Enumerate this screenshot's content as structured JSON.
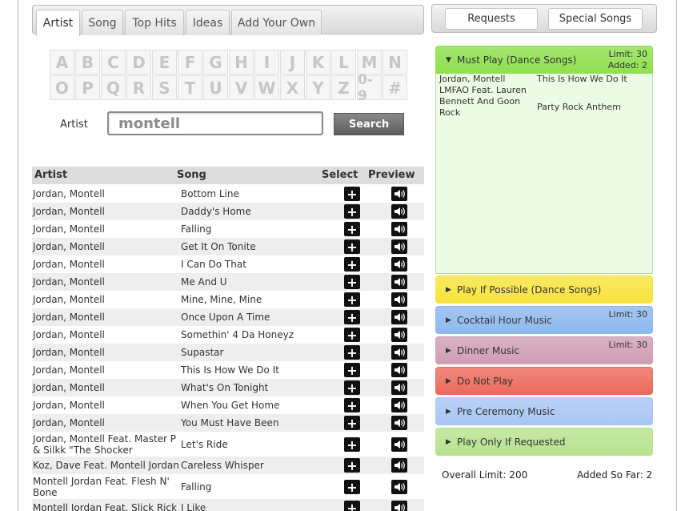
{
  "tabs": [
    {
      "label": "Artist",
      "active": true
    },
    {
      "label": "Song",
      "active": false
    },
    {
      "label": "Top Hits",
      "active": false
    },
    {
      "label": "Ideas",
      "active": false
    },
    {
      "label": "Add Your Own",
      "active": false
    }
  ],
  "letters": [
    "A",
    "B",
    "C",
    "D",
    "E",
    "F",
    "G",
    "H",
    "I",
    "J",
    "K",
    "L",
    "M",
    "N",
    "O",
    "P",
    "Q",
    "R",
    "S",
    "T",
    "U",
    "V",
    "W",
    "X",
    "Y",
    "Z",
    "0-9",
    "#"
  ],
  "search": {
    "label": "Artist",
    "value": "montell",
    "button": "Search"
  },
  "table": {
    "headers": {
      "artist": "Artist",
      "song": "Song",
      "select": "Select",
      "preview": "Preview"
    },
    "rows": [
      {
        "artist": "Jordan, Montell",
        "song": "Bottom Line"
      },
      {
        "artist": "Jordan, Montell",
        "song": "Daddy's Home"
      },
      {
        "artist": "Jordan, Montell",
        "song": "Falling"
      },
      {
        "artist": "Jordan, Montell",
        "song": "Get It On Tonite"
      },
      {
        "artist": "Jordan, Montell",
        "song": "I Can Do That"
      },
      {
        "artist": "Jordan, Montell",
        "song": "Me And U"
      },
      {
        "artist": "Jordan, Montell",
        "song": "Mine, Mine, Mine"
      },
      {
        "artist": "Jordan, Montell",
        "song": "Once Upon A Time"
      },
      {
        "artist": "Jordan, Montell",
        "song": "Somethin' 4 Da Honeyz"
      },
      {
        "artist": "Jordan, Montell",
        "song": "Supastar"
      },
      {
        "artist": "Jordan, Montell",
        "song": "This Is How We Do It"
      },
      {
        "artist": "Jordan, Montell",
        "song": "What's On Tonight"
      },
      {
        "artist": "Jordan, Montell",
        "song": "When You Get Home"
      },
      {
        "artist": "Jordan, Montell",
        "song": "You Must Have Been"
      },
      {
        "artist": "Jordan, Montell Feat. Master P & Silkk \"The Shocker",
        "song": "Let's Ride"
      },
      {
        "artist": "Koz, Dave Feat. Montell Jordan",
        "song": "Careless Whisper"
      },
      {
        "artist": "Montell Jordan Feat. Flesh N' Bone",
        "song": "Falling"
      },
      {
        "artist": "Montell Jordan Feat. Slick Rick",
        "song": "I Like"
      }
    ]
  },
  "right_tabs": [
    {
      "label": "Requests"
    },
    {
      "label": "Special Songs"
    }
  ],
  "categories": [
    {
      "name": "Must Play (Dance Songs)",
      "limit": "Limit: 30",
      "added": "Added: 2",
      "color": "#8fe04f",
      "expanded": true
    },
    {
      "name": "Play If Possible (Dance Songs)",
      "limit": "",
      "added": "",
      "color": "#f8e43c"
    },
    {
      "name": "Cocktail Hour Music",
      "limit": "Limit: 30",
      "added": "",
      "color": "#8db8ef"
    },
    {
      "name": "Dinner Music",
      "limit": "Limit: 30",
      "added": "",
      "color": "#cf9fb3"
    },
    {
      "name": "Do Not Play",
      "limit": "",
      "added": "",
      "color": "#ec6a5c"
    },
    {
      "name": "Pre Ceremony Music",
      "limit": "",
      "added": "",
      "color": "#a9c6f3"
    },
    {
      "name": "Play Only If Requested",
      "limit": "",
      "added": "",
      "color": "#b7e38f"
    }
  ],
  "selected_songs": [
    {
      "artist": "Jordan, Montell",
      "song": "This Is How We Do It"
    },
    {
      "artist": "LMFAO Feat. Lauren Bennett And Goon Rock",
      "song": "Party Rock Anthem"
    }
  ],
  "selected_artist_lines": [
    [
      "Jordan, Montell"
    ],
    [
      "LMFAO Feat. Lauren",
      "Bennett And Goon",
      "Rock"
    ]
  ],
  "totals": {
    "overall": "Overall Limit: 200",
    "added": "Added So Far: 2"
  }
}
